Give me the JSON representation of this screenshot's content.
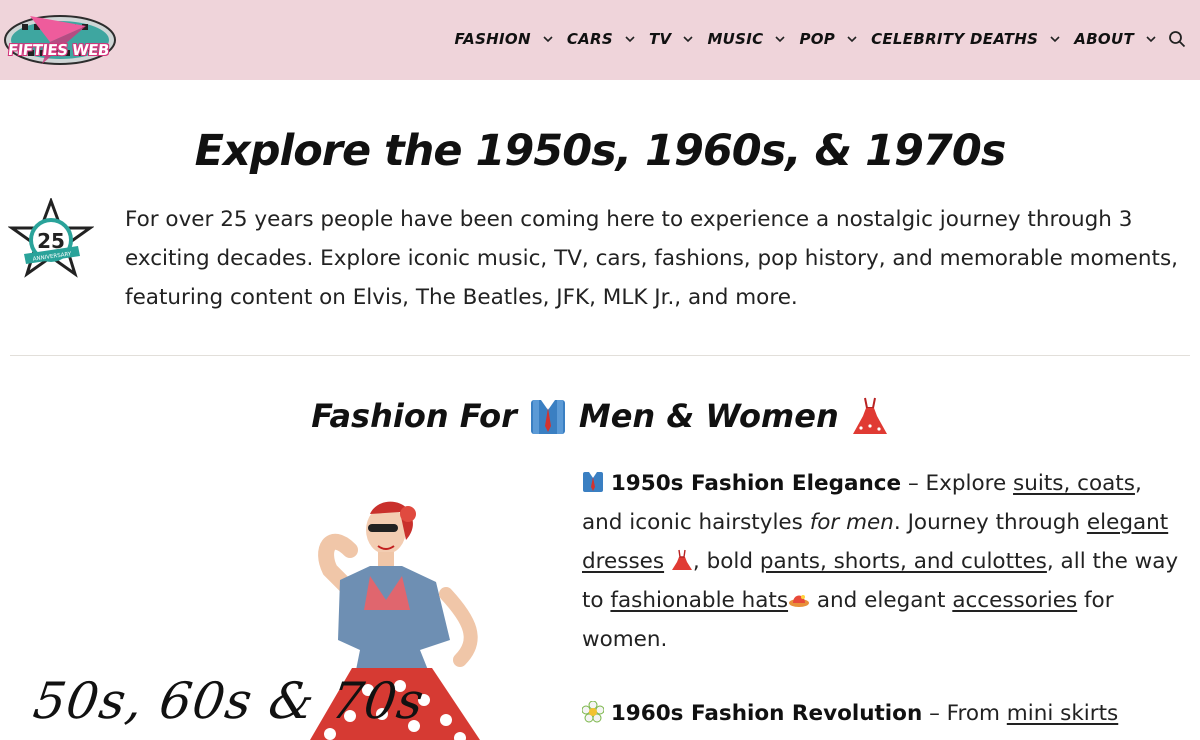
{
  "header": {
    "logo_text": "FIFTIES WEB",
    "nav": [
      {
        "label": "FASHION"
      },
      {
        "label": "CARS"
      },
      {
        "label": "TV"
      },
      {
        "label": "MUSIC"
      },
      {
        "label": "POP"
      },
      {
        "label": "CELEBRITY DEATHS"
      },
      {
        "label": "ABOUT"
      }
    ]
  },
  "hero": {
    "title": "Explore the 1950s, 1960s, & 1970s",
    "badge_number": "25",
    "badge_ribbon": "ANNIVERSARY",
    "intro": "For over 25 years people have been coming here to experience a nostalgic journey through 3 exciting decades. Explore iconic music, TV, cars, fashions, pop history, and memorable moments, featuring content on Elvis, The Beatles, JFK, MLK Jr., and more."
  },
  "fashion": {
    "title_a": "Fashion For",
    "title_b": "Men & Women",
    "image_caption": "50s, 60s & 70s",
    "p1": {
      "heading": "1950s Fashion Elegance",
      "t1": " – Explore ",
      "link1": "suits, coats",
      "t2": ", and iconic hairstyles ",
      "em": "for men",
      "t3": ". Journey through ",
      "link2": "elegant dresses",
      "t4": ", bold ",
      "link3": "pants, shorts, and culottes",
      "t5": ", all the way to ",
      "link4": "fashionable hats",
      "t6": " and elegant ",
      "link5": "accessories",
      "t7": " for women."
    },
    "p2": {
      "heading": "1960s Fashion Revolution",
      "t1": " – From ",
      "link1": "mini skirts"
    }
  },
  "colors": {
    "header_bg": "#efd4da",
    "brand_pink": "#d2337a",
    "teal": "#2aa39a"
  }
}
